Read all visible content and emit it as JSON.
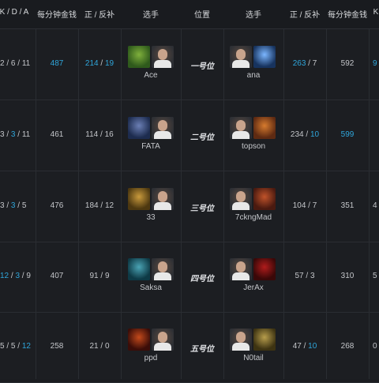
{
  "headers": {
    "kda_left": "K / D / A",
    "gpm_left": "每分钟金钱",
    "lh_left": "正 / 反补",
    "player_left": "选手",
    "position": "位置",
    "player_right": "选手",
    "lh_right": "正 / 反补",
    "gpm_right": "每分钟金钱",
    "kda_right_partial": "K"
  },
  "colors": {
    "highlight": "#2fa6db",
    "background": "#1c1e22"
  },
  "rows": [
    {
      "kda_left": [
        "2",
        "6",
        "11"
      ],
      "kda_left_hl": [
        false,
        false,
        false
      ],
      "gpm_left": "487",
      "gpm_left_hl": true,
      "lh_left": [
        "214",
        "19"
      ],
      "lh_left_hl": [
        true,
        true
      ],
      "left_hero_icon": "hero-portrait-green-orc",
      "left_player": "Ace",
      "position": "一号位",
      "right_player": "ana",
      "right_hero_icon": "hero-portrait-blue-spirit",
      "lh_right": [
        "263",
        "7"
      ],
      "lh_right_hl": [
        true,
        false
      ],
      "gpm_right": "592",
      "gpm_right_hl": false,
      "kda_right_partial": "9",
      "kda_right_partial_hl": true
    },
    {
      "kda_left": [
        "3",
        "3",
        "11"
      ],
      "kda_left_hl": [
        false,
        true,
        false
      ],
      "gpm_left": "461",
      "gpm_left_hl": false,
      "lh_left": [
        "114",
        "16"
      ],
      "lh_left_hl": [
        false,
        false
      ],
      "left_hero_icon": "hero-portrait-blue-brute",
      "left_player": "FATA",
      "position": "二号位",
      "right_player": "topson",
      "right_hero_icon": "hero-portrait-orange-beast",
      "lh_right": [
        "234",
        "10"
      ],
      "lh_right_hl": [
        false,
        true
      ],
      "gpm_right": "599",
      "gpm_right_hl": true,
      "kda_right_partial": "",
      "kda_right_partial_hl": false
    },
    {
      "kda_left": [
        "3",
        "3",
        "5"
      ],
      "kda_left_hl": [
        false,
        true,
        false
      ],
      "gpm_left": "476",
      "gpm_left_hl": false,
      "lh_left": [
        "184",
        "12"
      ],
      "lh_left_hl": [
        false,
        false
      ],
      "left_hero_icon": "hero-portrait-golden-beast",
      "left_player": "33",
      "position": "三号位",
      "right_player": "7ckngMad",
      "right_hero_icon": "hero-portrait-red-golem",
      "lh_right": [
        "104",
        "7"
      ],
      "lh_right_hl": [
        false,
        false
      ],
      "gpm_right": "351",
      "gpm_right_hl": false,
      "kda_right_partial": "4",
      "kda_right_partial_hl": false
    },
    {
      "kda_left": [
        "12",
        "3",
        "9"
      ],
      "kda_left_hl": [
        true,
        true,
        false
      ],
      "gpm_left": "407",
      "gpm_left_hl": false,
      "lh_left": [
        "91",
        "9"
      ],
      "lh_left_hl": [
        false,
        false
      ],
      "left_hero_icon": "hero-portrait-teal-mage",
      "left_player": "Saksa",
      "position": "四号位",
      "right_player": "JerAx",
      "right_hero_icon": "hero-portrait-crimson-demon",
      "lh_right": [
        "57",
        "3"
      ],
      "lh_right_hl": [
        false,
        false
      ],
      "gpm_right": "310",
      "gpm_right_hl": false,
      "kda_right_partial": "5",
      "kda_right_partial_hl": false
    },
    {
      "kda_left": [
        "5",
        "5",
        "12"
      ],
      "kda_left_hl": [
        false,
        false,
        true
      ],
      "gpm_left": "258",
      "gpm_left_hl": false,
      "lh_left": [
        "21",
        "0"
      ],
      "lh_left_hl": [
        false,
        false
      ],
      "left_hero_icon": "hero-portrait-fire-lord",
      "left_player": "ppd",
      "position": "五号位",
      "right_player": "N0tail",
      "right_hero_icon": "hero-portrait-gold-shaman",
      "lh_right": [
        "47",
        "10"
      ],
      "lh_right_hl": [
        false,
        true
      ],
      "gpm_right": "268",
      "gpm_right_hl": false,
      "kda_right_partial": "0",
      "kda_right_partial_hl": false
    }
  ]
}
